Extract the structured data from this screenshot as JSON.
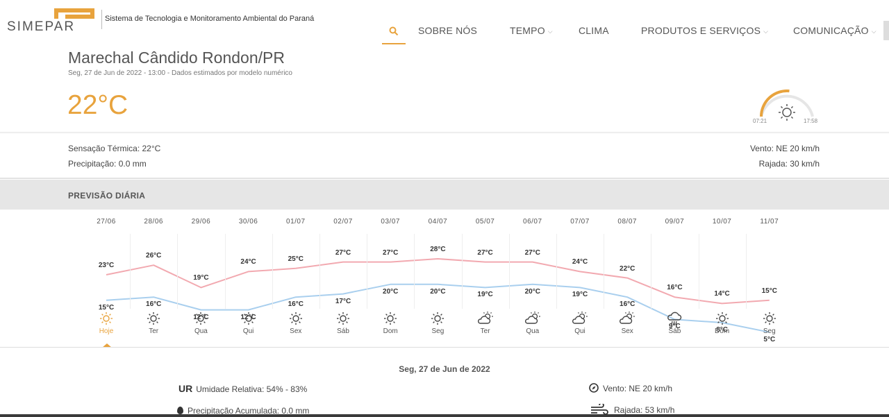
{
  "header": {
    "logo_text": "SIMEPAR",
    "tagline": "Sistema de Tecnologia e Monitoramento Ambiental do Paraná",
    "nav": [
      {
        "label": "SOBRE NÓS",
        "dropdown": false
      },
      {
        "label": "TEMPO",
        "dropdown": true
      },
      {
        "label": "CLIMA",
        "dropdown": false
      },
      {
        "label": "PRODUTOS E SERVIÇOS",
        "dropdown": true
      },
      {
        "label": "COMUNICAÇÃO",
        "dropdown": true
      }
    ],
    "search_icon": "search-icon",
    "accent": "#e8a33d"
  },
  "current": {
    "city": "Marechal Cândido Rondon/PR",
    "datetime": "Seg, 27 de Jun de 2022 - 13:00 - Dados estimados por modelo numérico",
    "temperature": "22°C",
    "sunrise": "07:21",
    "sunset": "17:58",
    "sun_progress": 0.53,
    "feels_like": "Sensação Térmica: 22°C",
    "precipitation": "Precipitação: 0.0 mm",
    "wind": "Vento: NE 20 km/h",
    "gust": "Rajada: 30 km/h"
  },
  "daily": {
    "title": "PREVISÃO DIÁRIA",
    "max_color": "#f2a9b0",
    "min_color": "#a9cfee",
    "days": [
      {
        "date": "27/06",
        "name": "Hoje",
        "max": 23,
        "min": 15,
        "max_label": "23°C",
        "min_label": "15°C",
        "icon": "sun-icon",
        "active": true
      },
      {
        "date": "28/06",
        "name": "Ter",
        "max": 26,
        "min": 16,
        "max_label": "26°C",
        "min_label": "16°C",
        "icon": "sun-icon"
      },
      {
        "date": "29/06",
        "name": "Qua",
        "max": 19,
        "min": 12,
        "max_label": "19°C",
        "min_label": "12°C",
        "icon": "sun-icon"
      },
      {
        "date": "30/06",
        "name": "Qui",
        "max": 24,
        "min": 12,
        "max_label": "24°C",
        "min_label": "12°C",
        "icon": "sun-icon"
      },
      {
        "date": "01/07",
        "name": "Sex",
        "max": 25,
        "min": 16,
        "max_label": "25°C",
        "min_label": "16°C",
        "icon": "sun-icon"
      },
      {
        "date": "02/07",
        "name": "Sáb",
        "max": 27,
        "min": 17,
        "max_label": "27°C",
        "min_label": "17°C",
        "icon": "sun-icon"
      },
      {
        "date": "03/07",
        "name": "Dom",
        "max": 27,
        "min": 20,
        "max_label": "27°C",
        "min_label": "20°C",
        "icon": "sun-icon"
      },
      {
        "date": "04/07",
        "name": "Seg",
        "max": 28,
        "min": 20,
        "max_label": "28°C",
        "min_label": "20°C",
        "icon": "sun-icon"
      },
      {
        "date": "05/07",
        "name": "Ter",
        "max": 27,
        "min": 19,
        "max_label": "27°C",
        "min_label": "19°C",
        "icon": "partly-cloudy-icon"
      },
      {
        "date": "06/07",
        "name": "Qua",
        "max": 27,
        "min": 20,
        "max_label": "27°C",
        "min_label": "20°C",
        "icon": "partly-cloudy-icon"
      },
      {
        "date": "07/07",
        "name": "Qui",
        "max": 24,
        "min": 19,
        "max_label": "24°C",
        "min_label": "19°C",
        "icon": "partly-cloudy-icon"
      },
      {
        "date": "08/07",
        "name": "Sex",
        "max": 22,
        "min": 16,
        "max_label": "22°C",
        "min_label": "16°C",
        "icon": "partly-cloudy-icon"
      },
      {
        "date": "09/07",
        "name": "Sáb",
        "max": 16,
        "min": 9,
        "max_label": "16°C",
        "min_label": "9°C",
        "icon": "rain-icon"
      },
      {
        "date": "10/07",
        "name": "Dom",
        "max": 14,
        "min": 8,
        "max_label": "14°C",
        "min_label": "8°C",
        "icon": "sun-icon"
      },
      {
        "date": "11/07",
        "name": "Seg",
        "max": 15,
        "min": 5,
        "max_label": "15°C",
        "min_label": "5°C",
        "icon": "sun-icon"
      }
    ]
  },
  "detail": {
    "date": "Seg, 27 de Jun de 2022",
    "ur_abbr": "UR",
    "humidity": "Umidade Relativa: 54% - 83%",
    "precip_accum": "Precipitação Acumulada: 0.0 mm",
    "wind": "Vento: NE 20 km/h",
    "gust": "Rajada: 53 km/h"
  }
}
